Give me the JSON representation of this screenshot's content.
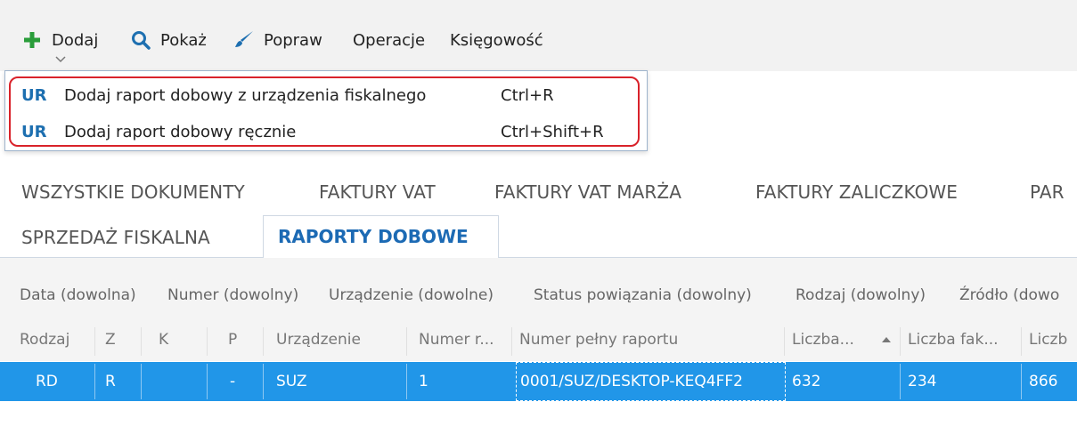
{
  "toolbar": {
    "add": {
      "label": "Dodaj",
      "icon": "plus-icon",
      "color": "#2a9d3a"
    },
    "show": {
      "label": "Pokaż",
      "icon": "search-icon",
      "color": "#1d6fb0"
    },
    "edit": {
      "label": "Popraw",
      "icon": "brush-icon",
      "color": "#1d6fb0"
    },
    "operations": {
      "label": "Operacje"
    },
    "accounting": {
      "label": "Księgowość"
    }
  },
  "dropdown": {
    "items": [
      {
        "badge": "UR",
        "label": "Dodaj raport dobowy z urządzenia fiskalnego",
        "shortcut": "Ctrl+R"
      },
      {
        "badge": "UR",
        "label": "Dodaj raport dobowy ręcznie",
        "shortcut": "Ctrl+Shift+R"
      }
    ],
    "highlight_color": "#d9222a"
  },
  "tabs": {
    "row1": [
      "WSZYSTKIE DOKUMENTY",
      "FAKTURY VAT",
      "FAKTURY VAT MARŻA",
      "FAKTURY ZALICZKOWE",
      "PAR"
    ],
    "row2": [
      "SPRZEDAŻ FISKALNA"
    ],
    "active": "RAPORTY DOBOWE",
    "active_color": "#1c6ab4"
  },
  "filters": [
    "Data (dowolna)",
    "Numer (dowolny)",
    "Urządzenie (dowolne)",
    "Status powiązania (dowolny)",
    "Rodzaj (dowolny)",
    "Źródło (dowo"
  ],
  "table": {
    "columns": [
      "Rodzaj",
      "Z",
      "K",
      "P",
      "Urządzenie",
      "Numer r...",
      "Numer pełny raportu",
      "Liczba...",
      "Liczba fak...",
      "Liczb"
    ],
    "rows": [
      {
        "rodzaj": "RD",
        "z": "R",
        "k": "",
        "p": "-",
        "urzadzenie": "SUZ",
        "numer": "1",
        "numer_pelny": "0001/SUZ/DESKTOP-KEQ4FF2",
        "liczba1": "632",
        "liczba2": "234",
        "liczba3": "866"
      }
    ],
    "selected_color": "#2196e8"
  }
}
